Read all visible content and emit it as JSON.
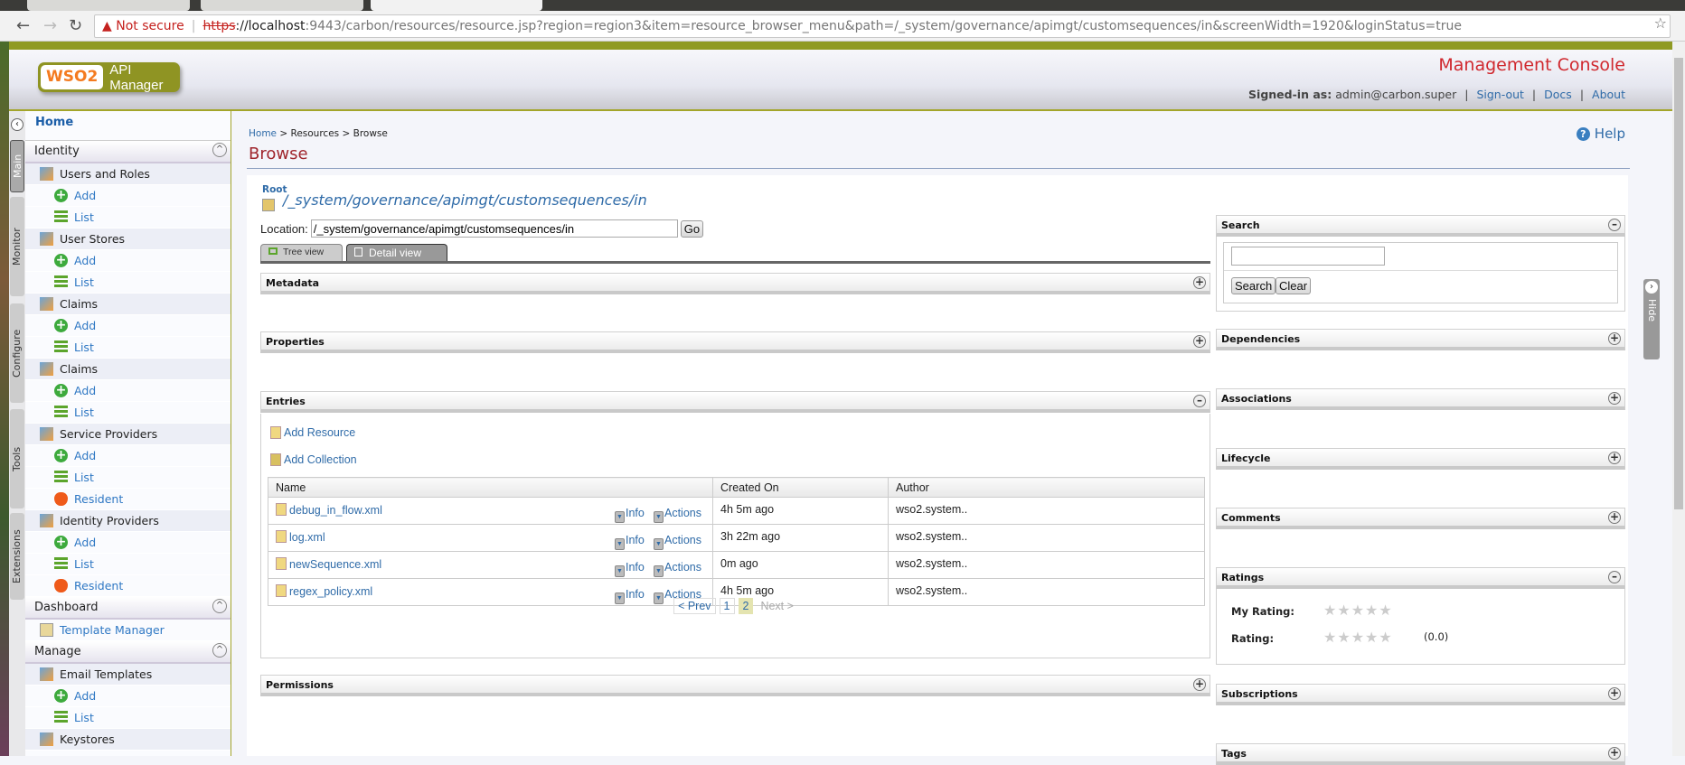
{
  "browser": {
    "warning": "Not secure",
    "url_scheme": "https",
    "url_host": "://localhost",
    "url_rest": ":9443/carbon/resources/resource.jsp?region=region3&item=resource_browser_menu&path=/_system/governance/apimgt/customsequences/in&screenWidth=1920&loginStatus=true"
  },
  "header": {
    "logo_wso2": "WSO2",
    "logo_product": "API Manager",
    "console_title": "Management Console",
    "signed_in_label": "Signed-in as:",
    "user": "admin@carbon.super",
    "signout": "Sign-out",
    "docs": "Docs",
    "about": "About"
  },
  "vtabs": [
    "Main",
    "Monitor",
    "Configure",
    "Tools",
    "Extensions"
  ],
  "sidebar": {
    "home": "Home",
    "sections": [
      {
        "title": "Identity",
        "items": [
          {
            "label": "Users and Roles",
            "icon": "users-roles-icon",
            "children": [
              "Add",
              "List"
            ]
          },
          {
            "label": "User Stores",
            "icon": "user-stores-icon",
            "children": [
              "Add",
              "List"
            ]
          },
          {
            "label": "Claims",
            "icon": "claims-icon",
            "children": [
              "Add",
              "List"
            ]
          },
          {
            "label": "Claims",
            "icon": "claims-icon",
            "children": [
              "Add",
              "List"
            ]
          },
          {
            "label": "Service Providers",
            "icon": "service-providers-icon",
            "children": [
              "Add",
              "List",
              "Resident"
            ]
          },
          {
            "label": "Identity Providers",
            "icon": "identity-providers-icon",
            "children": [
              "Add",
              "List",
              "Resident"
            ]
          }
        ]
      },
      {
        "title": "Dashboard",
        "links": [
          "Template Manager"
        ]
      },
      {
        "title": "Manage",
        "items": [
          {
            "label": "Email Templates",
            "icon": "email-templates-icon",
            "children": [
              "Add",
              "List"
            ]
          },
          {
            "label": "Keystores",
            "icon": "keystores-icon",
            "children": []
          }
        ]
      }
    ]
  },
  "page": {
    "breadcrumb": [
      "Home",
      "Resources",
      "Browse"
    ],
    "title": "Browse",
    "help": "Help",
    "root": "Root",
    "path": "/_system/governance/apimgt/customsequences/in",
    "location_label": "Location:",
    "location_value": "/_system/governance/apimgt/customsequences/in",
    "go": "Go",
    "tabs": [
      "Tree view",
      "Detail view"
    ]
  },
  "panels": {
    "metadata": "Metadata",
    "properties": "Properties",
    "entries": "Entries",
    "permissions": "Permissions"
  },
  "entries": {
    "add_resource": "Add Resource",
    "add_collection": "Add Collection",
    "columns": [
      "Name",
      "Created On",
      "Author"
    ],
    "info": "Info",
    "actions": "Actions",
    "rows": [
      {
        "name": "debug_in_flow.xml",
        "created": "4h 5m ago",
        "author": "wso2.system.."
      },
      {
        "name": "log.xml",
        "created": "3h 22m ago",
        "author": "wso2.system.."
      },
      {
        "name": "newSequence.xml",
        "created": "0m ago",
        "author": "wso2.system.."
      },
      {
        "name": "regex_policy.xml",
        "created": "4h 5m ago",
        "author": "wso2.system.."
      }
    ],
    "pager": {
      "prev": "< Prev",
      "pages": [
        "1",
        "2"
      ],
      "current": "2",
      "next": "Next >"
    }
  },
  "right": {
    "search": "Search",
    "search_button": "Search",
    "clear_button": "Clear",
    "hide": "Hide",
    "dependencies": "Dependencies",
    "associations": "Associations",
    "lifecycle": "Lifecycle",
    "comments": "Comments",
    "ratings": "Ratings",
    "my_rating_label": "My Rating:",
    "rating_label": "Rating:",
    "rating_value": "(0.0)",
    "my_rating_stars": 0,
    "rating_stars": 0,
    "subscriptions": "Subscriptions",
    "tags": "Tags"
  }
}
